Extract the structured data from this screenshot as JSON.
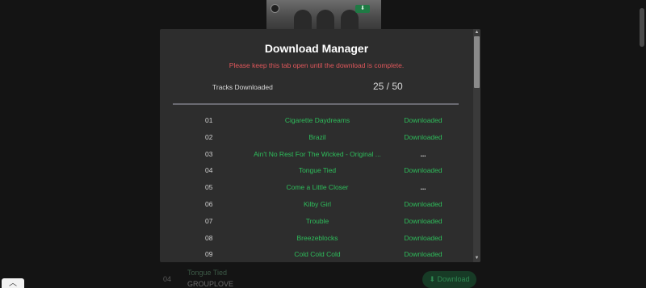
{
  "background": {
    "row": {
      "number": "04",
      "title": "Tongue Tied",
      "artist": "GROUPLOVE",
      "download_label": "Download",
      "download_icon": "download-icon"
    },
    "scroll_top_icon": "chevron-up-icon"
  },
  "modal": {
    "title": "Download Manager",
    "warning": "Please keep this tab open until the download is complete.",
    "progress_label": "Tracks Downloaded",
    "progress_count": "25 / 50",
    "progress_value": 0.5,
    "tracks": [
      {
        "number": "01",
        "title": "Cigarette Daydreams",
        "status": "Downloaded"
      },
      {
        "number": "02",
        "title": "Brazil",
        "status": "Downloaded"
      },
      {
        "number": "03",
        "title": "Ain't No Rest For The Wicked - Original ...",
        "status": "..."
      },
      {
        "number": "04",
        "title": "Tongue Tied",
        "status": "Downloaded"
      },
      {
        "number": "05",
        "title": "Come a Little Closer",
        "status": "..."
      },
      {
        "number": "06",
        "title": "Kilby Girl",
        "status": "Downloaded"
      },
      {
        "number": "07",
        "title": "Trouble",
        "status": "Downloaded"
      },
      {
        "number": "08",
        "title": "Breezeblocks",
        "status": "Downloaded"
      },
      {
        "number": "09",
        "title": "Cold Cold Cold",
        "status": "Downloaded"
      }
    ]
  },
  "colors": {
    "accent_green": "#2ebd5b",
    "warning_red": "#e0575b",
    "modal_bg": "#2d2d2d",
    "page_bg": "#141414"
  }
}
